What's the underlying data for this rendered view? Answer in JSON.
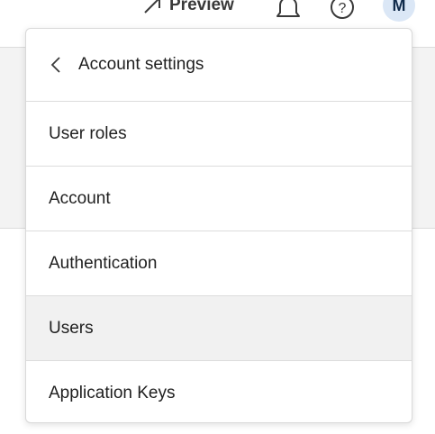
{
  "topbar": {
    "preview_label": "Preview",
    "avatar_initial": "M"
  },
  "menu": {
    "header_label": "Account settings",
    "items": [
      {
        "label": "User roles",
        "active": false
      },
      {
        "label": "Account",
        "active": false
      },
      {
        "label": "Authentication",
        "active": false
      },
      {
        "label": "Users",
        "active": true
      },
      {
        "label": "Application Keys",
        "active": false
      }
    ]
  },
  "colors": {
    "active_item_bg": "#f1f1f1",
    "avatar_bg": "#dbe7f6"
  }
}
